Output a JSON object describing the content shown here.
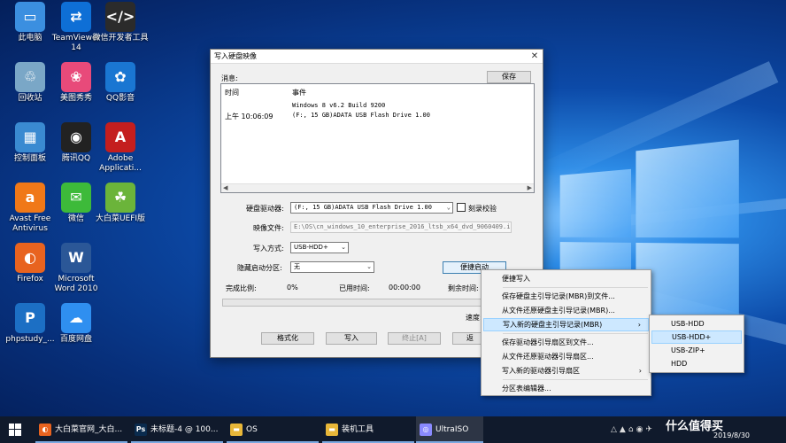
{
  "desktop": {
    "icons": [
      {
        "label": "此电脑",
        "glyph": "▭",
        "color": "#3b8fe0"
      },
      {
        "label": "TeamViewer 14",
        "glyph": "⇄",
        "color": "#0e6fd6"
      },
      {
        "label": "微信开发者工具",
        "glyph": "</>",
        "color": "#2b2b2b"
      },
      {
        "label": "回收站",
        "glyph": "♲",
        "color": "#7aa7c7"
      },
      {
        "label": "美图秀秀",
        "glyph": "❀",
        "color": "#e84a7a"
      },
      {
        "label": "QQ影音",
        "glyph": "✿",
        "color": "#1a76d2"
      },
      {
        "label": "控制面板",
        "glyph": "▦",
        "color": "#3a8ad1"
      },
      {
        "label": "腾讯QQ",
        "glyph": "◉",
        "color": "#222222"
      },
      {
        "label": "Adobe Applicati...",
        "glyph": "A",
        "color": "#c41e1e"
      },
      {
        "label": "Avast Free Antivirus",
        "glyph": "a",
        "color": "#f07818"
      },
      {
        "label": "微信",
        "glyph": "✉",
        "color": "#3dba3a"
      },
      {
        "label": "大白菜UEFI版",
        "glyph": "☘",
        "color": "#6bb43a"
      },
      {
        "label": "Firefox",
        "glyph": "◐",
        "color": "#e8631f"
      },
      {
        "label": "Microsoft Word 2010",
        "glyph": "W",
        "color": "#2b5797"
      },
      {
        "label": "phpstudy_...",
        "glyph": "P",
        "color": "#1c6fc4"
      },
      {
        "label": "百度网盘",
        "glyph": "☁",
        "color": "#2f8ff0"
      }
    ]
  },
  "dialog": {
    "title": "写入硬盘映像",
    "close": "✕",
    "message_label": "消息:",
    "save_button": "保存",
    "log_headers": {
      "time": "时间",
      "event": "事件"
    },
    "log_rows": [
      {
        "time": "",
        "event": "Windows 8 v6.2 Build 9200"
      },
      {
        "time": "上午 10:06:09",
        "event": "(F:, 15 GB)ADATA   USB Flash Drive 1.00"
      }
    ],
    "scroll_left": "◀",
    "scroll_right": "▶",
    "drive_label": "硬盘驱动器:",
    "drive_value": "(F:, 15 GB)ADATA   USB Flash Drive 1.00",
    "verify_label": "刻录校验",
    "image_label": "映像文件:",
    "image_value": "E:\\OS\\cn_windows_10_enterprise_2016_ltsb_x64_dvd_9060409.is",
    "write_mode_label": "写入方式:",
    "write_mode_value": "USB-HDD+",
    "hidden_partition_label": "隐藏启动分区:",
    "hidden_partition_value": "无",
    "quick_boot_button": "便捷启动",
    "completion_label": "完成比例:",
    "completion_value": "0%",
    "elapsed_label": "已用时间:",
    "elapsed_value": "00:00:00",
    "remaining_label": "剩余时间:",
    "speed_label": "速度:",
    "progress": 0,
    "buttons": {
      "format": "格式化",
      "write": "写入",
      "stop": "终止[A]",
      "back": "返"
    }
  },
  "context_menu": {
    "items": [
      "便捷写入",
      "保存硬盘主引导记录(MBR)到文件...",
      "从文件还原硬盘主引导记录(MBR)...",
      "写入新的硬盘主引导记录(MBR)",
      "保存驱动器引导扇区到文件...",
      "从文件还原驱动器引导扇区...",
      "写入新的驱动器引导扇区",
      "分区表编辑器..."
    ],
    "submenu_arrow": "›"
  },
  "submenu": {
    "items": [
      "USB-HDD",
      "USB-HDD+",
      "USB-ZIP+",
      "HDD"
    ]
  },
  "taskbar": {
    "items": [
      {
        "label": "大白菜官网_大白...",
        "icon": "◐",
        "color": "#e8631f"
      },
      {
        "label": "未标题-4 @ 100...",
        "icon": "Ps",
        "color": "#0a2b4e"
      },
      {
        "label": "OS",
        "icon": "▬",
        "color": "#e8b739"
      },
      {
        "label": "装机工具",
        "icon": "▬",
        "color": "#e8b739"
      },
      {
        "label": "UltraISO",
        "icon": "◎",
        "color": "#8a8aff"
      }
    ],
    "tray_icons": [
      "△",
      "▲",
      "⌂",
      "◉",
      "✈"
    ],
    "watermark": "什么值得买",
    "date": "2019/8/30"
  }
}
